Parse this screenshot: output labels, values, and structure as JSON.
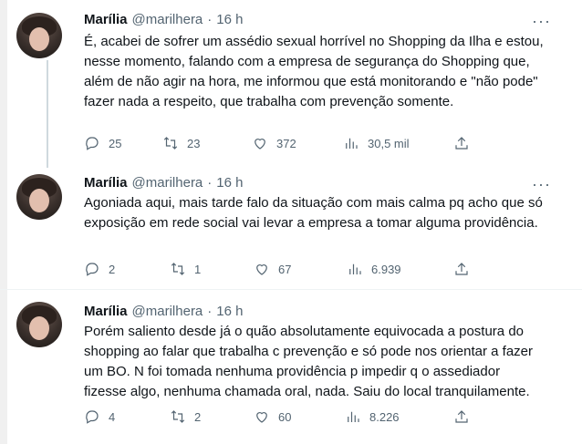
{
  "tweets": [
    {
      "name": "Marília",
      "handle": "@marilhera",
      "dot": "·",
      "time": "16 h",
      "more": "···",
      "text": "É, acabei de sofrer um assédio sexual horrível no Shopping da Ilha e estou, nesse momento, falando com a empresa de segurança do Shopping que, além de não agir na hora, me informou que está monitorando e \"não pode\" fazer nada a respeito, que trabalha com prevenção somente.",
      "replies": "25",
      "retweets": "23",
      "likes": "372",
      "views": "30,5 mil"
    },
    {
      "name": "Marília",
      "handle": "@marilhera",
      "dot": "·",
      "time": "16 h",
      "more": "···",
      "text": "Agoniada aqui, mais tarde falo da situação com mais calma pq acho que só exposição em rede social vai levar a empresa a tomar alguma providência.",
      "replies": "2",
      "retweets": "1",
      "likes": "67",
      "views": "6.939"
    },
    {
      "name": "Marília",
      "handle": "@marilhera",
      "dot": "·",
      "time": "16 h",
      "more": "",
      "text": "Porém saliento desde já o quão absolutamente equivocada a postura do shopping ao falar que trabalha c prevenção e só pode nos orientar a fazer um BO. N foi tomada nenhuma providência p impedir q o assediador fizesse algo, nenhuma chamada oral, nada. Saiu do local tranquilamente.",
      "replies": "4",
      "retweets": "2",
      "likes": "60",
      "views": "8.226"
    }
  ],
  "icons": {
    "reply": "reply-icon",
    "retweet": "retweet-icon",
    "like": "like-icon",
    "views": "views-icon",
    "share": "share-icon",
    "more": "more-icon"
  },
  "colors": {
    "text": "#0f1419",
    "secondary": "#536471",
    "thread_line": "#cfd9de",
    "divider": "#eff3f4"
  }
}
